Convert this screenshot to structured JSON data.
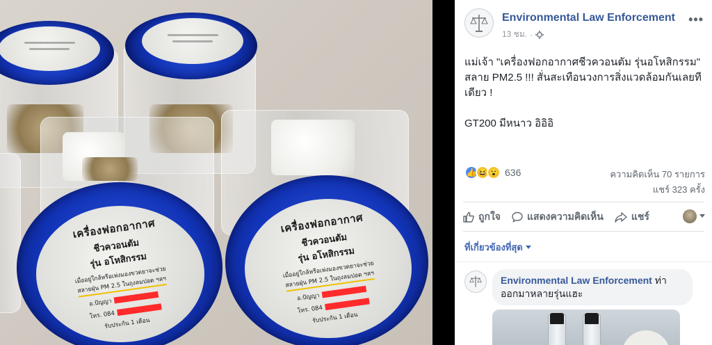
{
  "photo": {
    "label_left": {
      "title": "เครื่องฟอกอากาศ",
      "subtitle": "ชีวควอนตัม",
      "model": "รุ่น อโหสิกรรม",
      "line1": "เมื่ออยู่ใกล้หรือเพ่งมองขวดยาจะช่วย",
      "line2": "สลายฝุ่น PM 2.5 ในถุงลมปอด ฯลฯ",
      "maker_prefix": "อ.ปัญญา",
      "phone_prefix": "โทร. 084",
      "warranty": "รับประกัน 1 เดือน"
    },
    "label_right": {
      "title": "เครื่องฟอกอากาศ",
      "subtitle": "ชีวควอนตัม",
      "model": "รุ่น อโหสิกรรม",
      "line1": "เมื่ออยู่ใกล้หรือเพ่งมองขวดยาจะช่วย",
      "line2": "สลายฝุ่น PM 2.5 ในถุงลมปอด ฯลฯ",
      "maker_prefix": "อ.ปัญญา",
      "phone_prefix": "โทร. 084",
      "warranty": "รับประกัน 1 เดือน"
    }
  },
  "post": {
    "page_name": "Environmental Law Enforcement",
    "time": "13 ชม.",
    "more_label": "•••",
    "text_para1": "แม่เจ้า \"เครื่องฟอกอากาศชีวควอนตัม รุ่นอโหสิกรรม\" สลาย PM2.5 !!! สั่นสะเทือนวงการสิ่งแวดล้อมกันเลยทีเดียว !",
    "text_para2": "GT200 มีหนาว อิอิอิ",
    "reaction_count": "636",
    "comments_count": "ความคิดเห็น 70 รายการ",
    "shares_count": "แชร์ 323 ครั้ง",
    "reactions": [
      "like-icon",
      "haha-icon",
      "wow-icon"
    ]
  },
  "actions": {
    "like": "ถูกใจ",
    "comment": "แสดงความคิดเห็น",
    "share": "แชร์"
  },
  "comments": {
    "sort_label": "ที่เกี่ยวข้องที่สุด",
    "first": {
      "author": "Environmental Law Enforcement",
      "text": "ท่าออกมาหลายรุ่นแฮะ"
    }
  },
  "colors": {
    "link": "#365899",
    "cap_blue": "#1234b8",
    "redaction": "#ff2b2b"
  }
}
